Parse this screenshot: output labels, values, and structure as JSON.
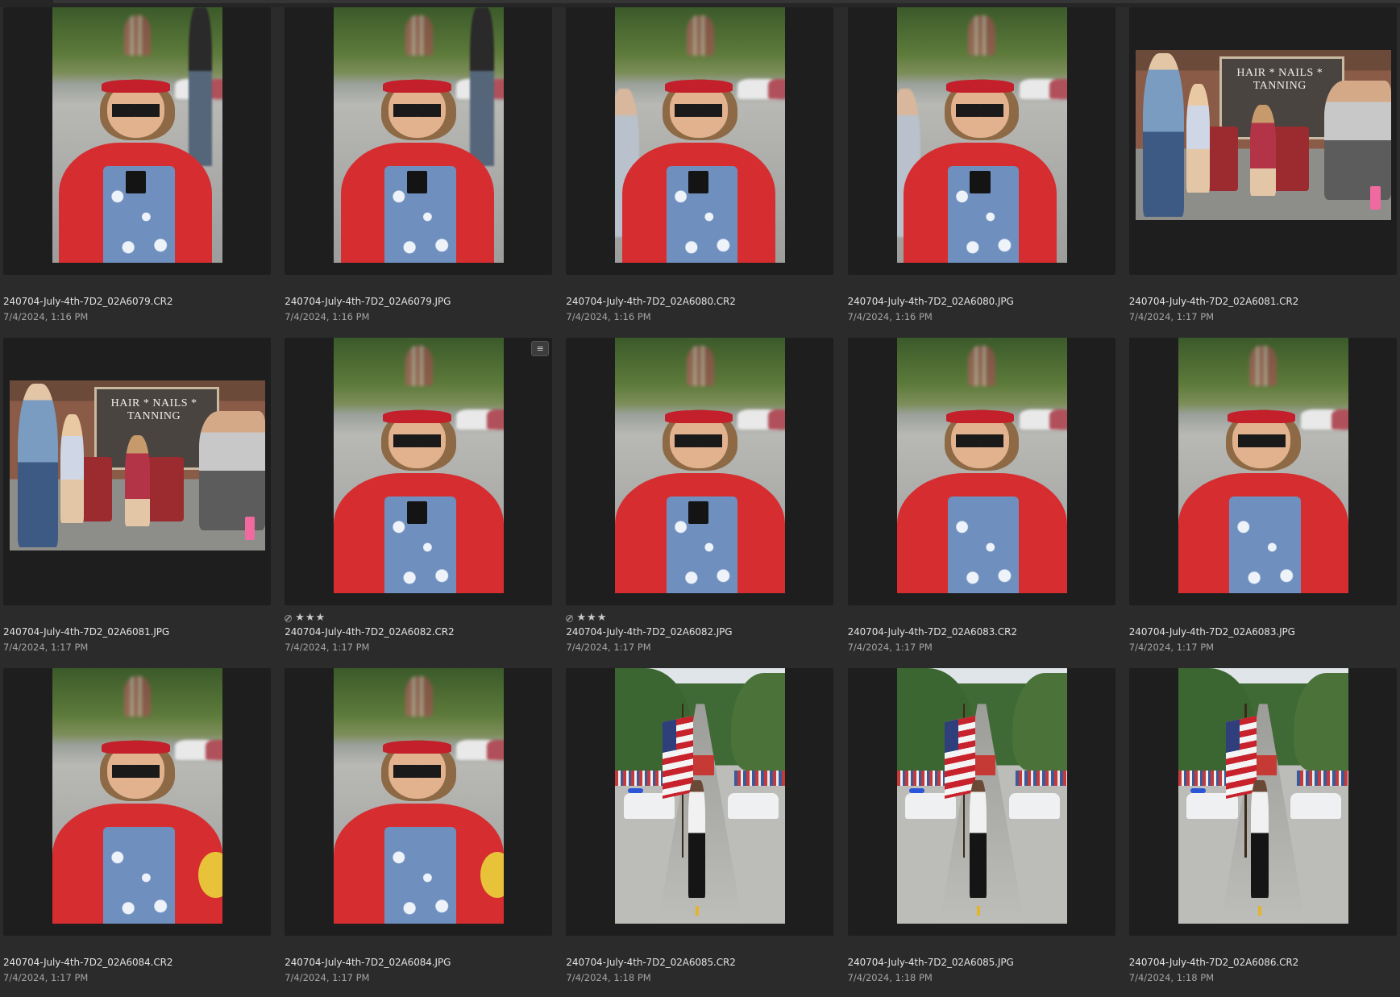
{
  "grid": {
    "tiles": [
      {
        "filename": "240704-July-4th-7D2_02A6079.CR2",
        "date": "7/4/2024, 1:16 PM",
        "orientation": "portrait",
        "scene": "girl",
        "rating": null,
        "edited": false
      },
      {
        "filename": "240704-July-4th-7D2_02A6079.JPG",
        "date": "7/4/2024, 1:16 PM",
        "orientation": "portrait",
        "scene": "girl",
        "rating": null,
        "edited": false
      },
      {
        "filename": "240704-July-4th-7D2_02A6080.CR2",
        "date": "7/4/2024, 1:16 PM",
        "orientation": "portrait",
        "scene": "girl",
        "rating": null,
        "edited": false
      },
      {
        "filename": "240704-July-4th-7D2_02A6080.JPG",
        "date": "7/4/2024, 1:16 PM",
        "orientation": "portrait",
        "scene": "girl",
        "rating": null,
        "edited": false
      },
      {
        "filename": "240704-July-4th-7D2_02A6081.CR2",
        "date": "7/4/2024, 1:17 PM",
        "orientation": "landscape",
        "scene": "store",
        "rating": null,
        "edited": false
      },
      {
        "filename": "240704-July-4th-7D2_02A6081.JPG",
        "date": "7/4/2024, 1:17 PM",
        "orientation": "landscape",
        "scene": "store",
        "rating": null,
        "edited": false
      },
      {
        "filename": "240704-July-4th-7D2_02A6082.CR2",
        "date": "7/4/2024, 1:17 PM",
        "orientation": "portrait",
        "scene": "girl",
        "rating": 3,
        "edited": true
      },
      {
        "filename": "240704-July-4th-7D2_02A6082.JPG",
        "date": "7/4/2024, 1:17 PM",
        "orientation": "portrait",
        "scene": "girl",
        "rating": 3,
        "edited": false
      },
      {
        "filename": "240704-July-4th-7D2_02A6083.CR2",
        "date": "7/4/2024, 1:17 PM",
        "orientation": "portrait",
        "scene": "girl",
        "rating": null,
        "edited": false
      },
      {
        "filename": "240704-July-4th-7D2_02A6083.JPG",
        "date": "7/4/2024, 1:17 PM",
        "orientation": "portrait",
        "scene": "girl",
        "rating": null,
        "edited": false
      },
      {
        "filename": "240704-July-4th-7D2_02A6084.CR2",
        "date": "7/4/2024, 1:17 PM",
        "orientation": "portrait",
        "scene": "girl",
        "rating": null,
        "edited": false
      },
      {
        "filename": "240704-July-4th-7D2_02A6084.JPG",
        "date": "7/4/2024, 1:17 PM",
        "orientation": "portrait",
        "scene": "girl",
        "rating": null,
        "edited": false
      },
      {
        "filename": "240704-July-4th-7D2_02A6085.CR2",
        "date": "7/4/2024, 1:18 PM",
        "orientation": "portrait",
        "scene": "parade",
        "rating": null,
        "edited": false
      },
      {
        "filename": "240704-July-4th-7D2_02A6085.JPG",
        "date": "7/4/2024, 1:18 PM",
        "orientation": "portrait",
        "scene": "parade",
        "rating": null,
        "edited": false
      },
      {
        "filename": "240704-July-4th-7D2_02A6086.CR2",
        "date": "7/4/2024, 1:18 PM",
        "orientation": "portrait",
        "scene": "parade",
        "rating": null,
        "edited": false
      }
    ]
  },
  "store_sign_text": "HAIR * NAILS * TANNING",
  "icons": {
    "reject": "reject-icon",
    "star": "star-icon",
    "edit": "adjustments-icon"
  },
  "colors": {
    "background": "#2b2b2b",
    "tile": "#1e1e1e",
    "filename": "#e2e2e2",
    "date": "#a4a4a4"
  }
}
